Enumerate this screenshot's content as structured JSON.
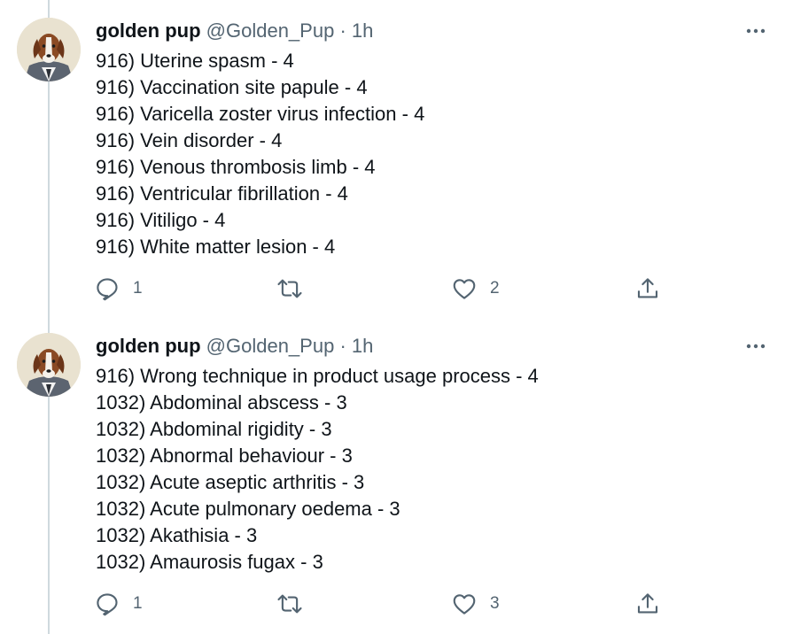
{
  "tweets": [
    {
      "author": {
        "name": "golden pup",
        "handle": "@Golden_Pup"
      },
      "separator": "·",
      "time": "1h",
      "lines": [
        "916) Uterine spasm - 4",
        "916) Vaccination site papule - 4",
        "916) Varicella zoster virus infection - 4",
        "916) Vein disorder - 4",
        "916) Venous thrombosis limb - 4",
        "916) Ventricular fibrillation - 4",
        "916) Vitiligo - 4",
        "916) White matter lesion - 4"
      ],
      "reply_count": "1",
      "retweet_count": "",
      "like_count": "2"
    },
    {
      "author": {
        "name": "golden pup",
        "handle": "@Golden_Pup"
      },
      "separator": "·",
      "time": "1h",
      "lines": [
        "916) Wrong technique in product usage process - 4",
        "1032) Abdominal abscess - 3",
        "1032) Abdominal rigidity - 3",
        "1032) Abnormal behaviour - 3",
        "1032) Acute aseptic arthritis - 3",
        "1032) Acute pulmonary oedema - 3",
        "1032) Akathisia - 3",
        "1032) Amaurosis fugax - 3"
      ],
      "reply_count": "1",
      "retweet_count": "",
      "like_count": "3"
    }
  ],
  "icons": {
    "more": "more-horizontal-icon",
    "reply": "reply-icon",
    "retweet": "retweet-icon",
    "like": "heart-icon",
    "share": "share-icon"
  },
  "colors": {
    "text": "#0f1419",
    "secondary": "#536471",
    "thread_line": "#cfd9de"
  }
}
